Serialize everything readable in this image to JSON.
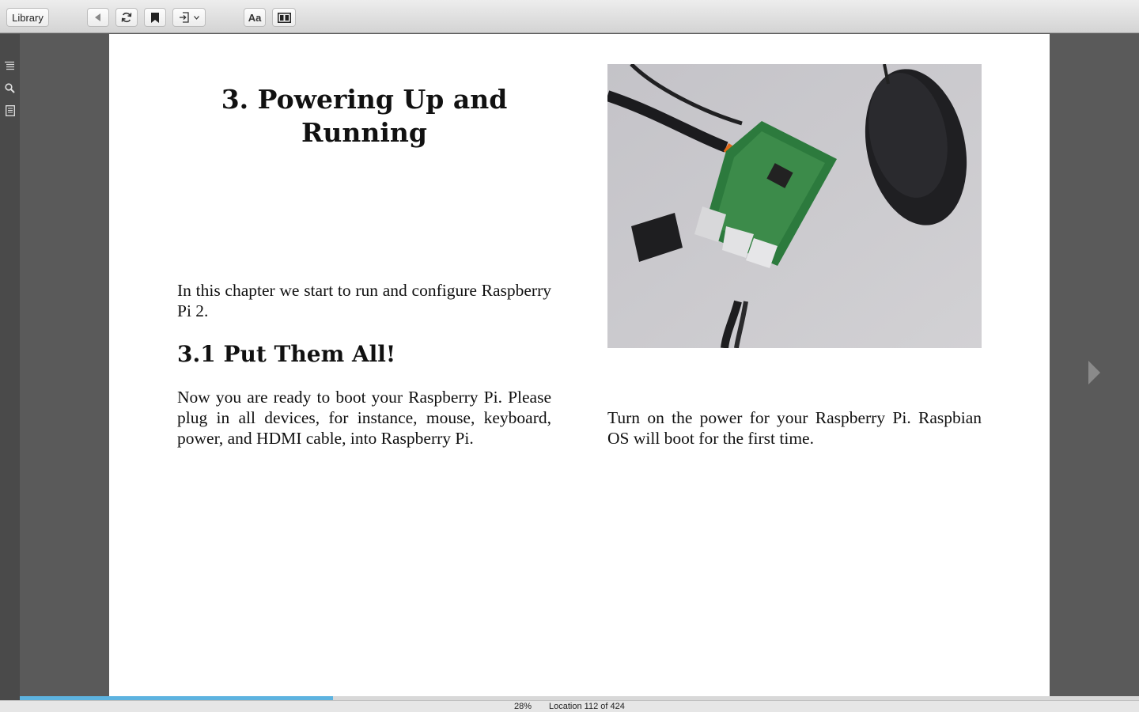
{
  "toolbar": {
    "library_label": "Library",
    "font_label": "Aa",
    "icons": [
      "back-arrow-icon",
      "sync-icon",
      "bookmark-icon",
      "go-to-icon",
      "chevron-down-icon",
      "two-column-layout-icon"
    ]
  },
  "sidebar": {
    "icons": [
      "table-of-contents-icon",
      "search-icon",
      "notes-icon"
    ]
  },
  "page": {
    "chapter_title": "3. Powering Up and Running",
    "intro": "In this chapter we start to run and configure Raspberry Pi 2.",
    "section_heading": "3.1 Put Them All!",
    "section_body": "Now you are ready to boot your Raspberry Pi. Please plug in all devices, for instance, mouse, keyboard, power, and HDMI cable, into Raspberry Pi.",
    "right_body": "Turn on the power for your Raspberry Pi. Raspbian OS will boot for the first time."
  },
  "status": {
    "percent": "28%",
    "location": "Location 112 of 424",
    "progress_fraction": 0.28
  },
  "colors": {
    "progress": "#5db3e0",
    "background": "#5a5a5a",
    "page": "#ffffff"
  }
}
